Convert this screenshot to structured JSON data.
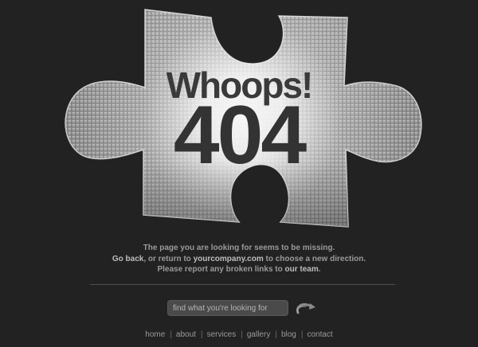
{
  "hero": {
    "title": "Whoops!",
    "code": "404"
  },
  "message": {
    "line1": "The page you are looking for seems to be missing.",
    "line2_link_back": "Go back",
    "line2_text": ", or return to ",
    "line2_link_site": "yourcompany.com",
    "line2_end": " to choose a new direction.",
    "line3_text": "Please report any broken links to ",
    "line3_link": "our team",
    "line3_end": "."
  },
  "search": {
    "placeholder": "find what you're looking for",
    "value": ""
  },
  "go_button": {
    "icon": "curved-arrow-icon"
  },
  "footer_nav": [
    {
      "label": "home"
    },
    {
      "label": "about"
    },
    {
      "label": "services"
    },
    {
      "label": "gallery"
    },
    {
      "label": "blog"
    },
    {
      "label": "contact"
    }
  ],
  "footer_separator": "|",
  "colors": {
    "background": "#222222",
    "puzzle_fill": "#8a8a8a",
    "puzzle_highlight": "#ffffff",
    "text": "#9a9a9a",
    "link": "#bdbdbd"
  }
}
